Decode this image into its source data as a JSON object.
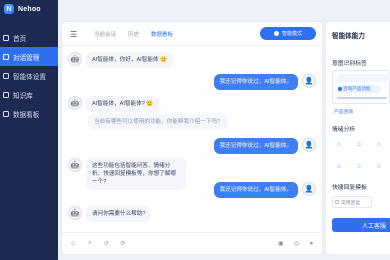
{
  "brand": {
    "logo_letter": "N",
    "name": "Nehoo"
  },
  "sidebar": {
    "items": [
      {
        "label": "首页",
        "active": false
      },
      {
        "label": "对话管理",
        "active": true
      },
      {
        "label": "智能体设置",
        "active": false
      },
      {
        "label": "知识库",
        "active": false
      },
      {
        "label": "数据看板",
        "active": false
      }
    ]
  },
  "chat": {
    "tabs": [
      "当前会话",
      "历史",
      "数据看板"
    ],
    "active_tab": 2,
    "mode_button": "智能模式",
    "messages": [
      {
        "side": "left",
        "text": "AI智能体，你好，AI智能体 🙂"
      },
      {
        "side": "right",
        "text": "我还记得你说过，AI智能体。"
      },
      {
        "side": "left",
        "text": "AI智能体，AI智能体? 🙂"
      },
      {
        "side": "left",
        "text": "当前有哪些可以使用的功能，你能帮我介绍一下吗?",
        "faint": true
      },
      {
        "side": "right",
        "text": "我还记得你说过，AI智能体。"
      },
      {
        "side": "left",
        "text": "这些功能包括智能问答、情绪分析、快速回复模板等，你想了解哪一个?"
      },
      {
        "side": "right",
        "text": "我还记得你说过，AI智能体。"
      },
      {
        "side": "left",
        "text": "请问你需要什么帮助?"
      }
    ],
    "footer_icons": [
      "emoji-icon",
      "attach-icon",
      "history-icon",
      "refresh-icon",
      "image-icon",
      "mic-icon",
      "send-icon"
    ]
  },
  "panel": {
    "title": "智能体能力",
    "intent_title": "意图识别标签",
    "intent_tag": "咨询产品功能",
    "intent_label": "产品咨询",
    "emotion_title": "情绪分析",
    "emotions": [
      "☺",
      "☺",
      "☺",
      "☺",
      "☺",
      "☺"
    ],
    "quick_title": "快捷回复模板",
    "quick_select": "常用回复",
    "human_button": "人工客服"
  },
  "colors": {
    "sidebar_bg": "#1d2b52",
    "accent": "#2f6ff0",
    "page_bg": "#eef2f8"
  }
}
